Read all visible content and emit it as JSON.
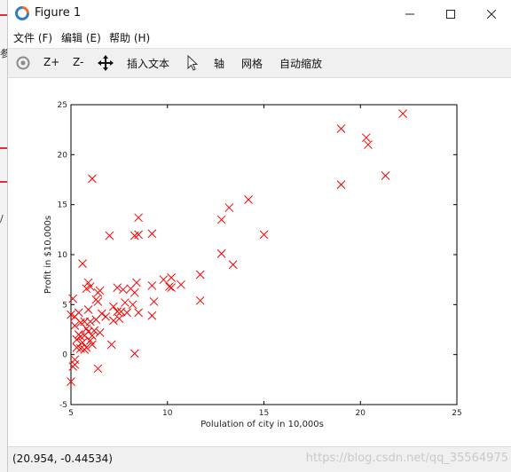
{
  "window": {
    "title": "Figure 1",
    "menu": [
      "文件 (F)",
      "编辑 (E)",
      "帮助 (H)"
    ]
  },
  "background_window": {
    "fragments": [
      "参",
      "/"
    ]
  },
  "toolbar": {
    "zoom_in_label": "Z+",
    "zoom_out_label": "Z-",
    "insert_text_label": "插入文本",
    "axis_label": "轴",
    "grid_label": "网格",
    "autoscale_label": "自动缩放"
  },
  "status": {
    "coords": "(20.954, -0.44534)",
    "watermark": "https://blog.csdn.net/qq_35564975"
  },
  "colors": {
    "marker": "#ff0000",
    "toolbar_bg": "#f0f0f0"
  },
  "chart_data": {
    "type": "scatter",
    "title": "",
    "xlabel": "Polulation of city in 10,000s",
    "ylabel": "Profit in $10,000s",
    "xlim": [
      5,
      25
    ],
    "ylim": [
      -5,
      25
    ],
    "xticks": [
      5,
      10,
      15,
      20,
      25
    ],
    "yticks": [
      -5,
      0,
      5,
      10,
      15,
      20,
      25
    ],
    "marker": "x",
    "grid": false,
    "points": [
      [
        22.2,
        24.1
      ],
      [
        19.0,
        22.6
      ],
      [
        20.3,
        21.7
      ],
      [
        20.4,
        21.0
      ],
      [
        21.3,
        17.9
      ],
      [
        19.0,
        17.0
      ],
      [
        6.1,
        17.6
      ],
      [
        14.2,
        15.5
      ],
      [
        13.2,
        14.7
      ],
      [
        12.8,
        13.5
      ],
      [
        8.5,
        13.7
      ],
      [
        15.0,
        12.0
      ],
      [
        7.0,
        11.9
      ],
      [
        8.3,
        11.9
      ],
      [
        8.5,
        12.0
      ],
      [
        9.2,
        12.1
      ],
      [
        12.8,
        10.1
      ],
      [
        13.4,
        9.0
      ],
      [
        5.6,
        9.1
      ],
      [
        5.9,
        7.2
      ],
      [
        6.0,
        6.8
      ],
      [
        5.8,
        6.6
      ],
      [
        8.4,
        7.2
      ],
      [
        9.8,
        7.5
      ],
      [
        10.2,
        7.7
      ],
      [
        10.7,
        7.0
      ],
      [
        11.7,
        8.0
      ],
      [
        10.2,
        6.7
      ],
      [
        10.1,
        6.8
      ],
      [
        9.2,
        6.9
      ],
      [
        8.1,
        6.6
      ],
      [
        8.3,
        6.2
      ],
      [
        7.7,
        6.5
      ],
      [
        7.4,
        6.7
      ],
      [
        6.5,
        6.4
      ],
      [
        6.4,
        6.2
      ],
      [
        6.4,
        5.3
      ],
      [
        6.3,
        5.5
      ],
      [
        5.1,
        5.6
      ],
      [
        11.7,
        5.4
      ],
      [
        9.3,
        5.3
      ],
      [
        8.2,
        5.0
      ],
      [
        7.2,
        4.8
      ],
      [
        7.4,
        4.3
      ],
      [
        7.6,
        4.3
      ],
      [
        7.9,
        4.2
      ],
      [
        8.5,
        4.2
      ],
      [
        7.5,
        3.6
      ],
      [
        7.2,
        3.4
      ],
      [
        6.8,
        3.8
      ],
      [
        9.2,
        3.9
      ],
      [
        6.3,
        3.5
      ],
      [
        6.0,
        3.3
      ],
      [
        5.7,
        3.3
      ],
      [
        5.5,
        3.2
      ],
      [
        5.2,
        3.8
      ],
      [
        5.0,
        4.0
      ],
      [
        6.2,
        2.4
      ],
      [
        5.9,
        2.3
      ],
      [
        5.4,
        2.0
      ],
      [
        5.2,
        2.9
      ],
      [
        5.7,
        1.9
      ],
      [
        5.5,
        1.8
      ],
      [
        6.0,
        1.4
      ],
      [
        6.1,
        1.0
      ],
      [
        5.8,
        0.7
      ],
      [
        5.5,
        0.6
      ],
      [
        5.3,
        0.7
      ],
      [
        5.7,
        0.5
      ],
      [
        5.2,
        -0.5
      ],
      [
        5.2,
        -1.0
      ],
      [
        5.1,
        -1.2
      ],
      [
        6.4,
        -1.4
      ],
      [
        8.3,
        0.1
      ],
      [
        7.1,
        1.0
      ],
      [
        5.0,
        -2.7
      ],
      [
        5.3,
        1.5
      ],
      [
        5.6,
        1.2
      ],
      [
        5.8,
        2.6
      ],
      [
        6.1,
        1.9
      ],
      [
        6.5,
        2.2
      ],
      [
        5.4,
        4.2
      ],
      [
        5.9,
        4.5
      ],
      [
        6.6,
        4.1
      ],
      [
        7.8,
        5.2
      ]
    ]
  }
}
